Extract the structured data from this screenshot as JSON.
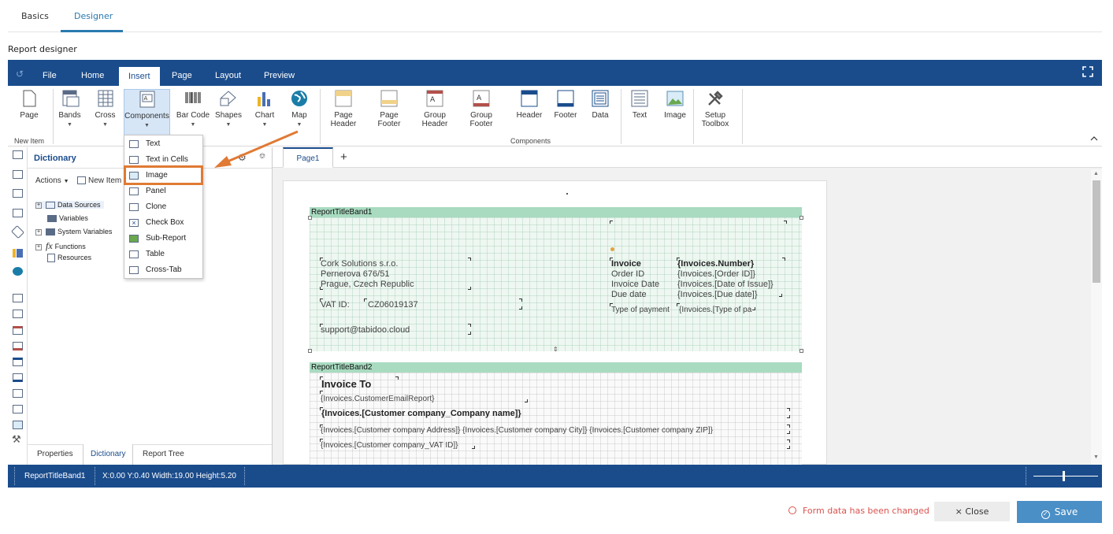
{
  "top_tabs": [
    "Basics",
    "Designer"
  ],
  "section_title": "Report designer",
  "ribbon": {
    "tabs": [
      "File",
      "Home",
      "Insert",
      "Page",
      "Layout",
      "Preview"
    ],
    "buttons": {
      "page": "Page",
      "bands": "Bands",
      "cross": "Cross",
      "components": "Components",
      "barcode": "Bar Code",
      "shapes": "Shapes",
      "chart": "Chart",
      "map": "Map",
      "page_header_1": "Page",
      "page_header_2": "Header",
      "page_footer_1": "Page",
      "page_footer_2": "Footer",
      "group_header_1": "Group",
      "group_header_2": "Header",
      "group_footer_1": "Group",
      "group_footer_2": "Footer",
      "header": "Header",
      "footer": "Footer",
      "data": "Data",
      "text": "Text",
      "image": "Image",
      "setup_toolbox_1": "Setup",
      "setup_toolbox_2": "Toolbox"
    },
    "group_new_item": "New Item",
    "group_components": "Components"
  },
  "dictionary": {
    "title": "Dictionary",
    "actions": "Actions",
    "new_item": "New Item",
    "tree": [
      "Data Sources",
      "Variables",
      "System Variables",
      "Functions",
      "Resources"
    ],
    "bottom_tabs": [
      "Properties",
      "Dictionary",
      "Report Tree"
    ]
  },
  "components_menu": {
    "items": [
      "Text",
      "Text in Cells",
      "Image",
      "Panel",
      "Clone",
      "Check Box",
      "Sub-Report",
      "Table",
      "Cross-Tab"
    ]
  },
  "page_tab": "Page1",
  "report": {
    "band1_name": "ReportTitleBand1",
    "band2_name": "ReportTitleBand2",
    "company_line1": "Cork Solutions s.r.o.",
    "company_line2": "Pernerova 676/51",
    "company_line3": "Prague, Czech Republic",
    "vat_label": "VAT ID:",
    "vat_value": "CZ06019137",
    "support_email": "support@tabidoo.cloud",
    "invoice_label": "Invoice",
    "order_id_label": "Order ID",
    "invoice_date_label": "Invoice Date",
    "due_date_label": "Due date",
    "invoice_number": "{Invoices.Number}",
    "order_id_value": "{Invoices.[Order ID]}",
    "date_of_issue": "{Invoices.[Date of Issue]}",
    "due_date_value": "{Invoices.[Due date]}",
    "payment_label": "Type of payment",
    "payment_value": "{Invoices.[Type of pa",
    "invoice_to": "Invoice To",
    "customer_email": "{Invoices.CustomerEmailReport}",
    "customer_company": "{Invoices.[Customer company_Company name]}",
    "customer_address": "{Invoices.[Customer company  Address]} {Invoices.[Customer company  City]} {Invoices.[Customer company  ZIP]}",
    "customer_vat": "{Invoices.[Customer company_VAT ID]}"
  },
  "status_bar": {
    "component": "ReportTitleBand1",
    "geometry": "X:0.00 Y:0.40 Width:19.00 Height:5.20"
  },
  "footer": {
    "changed": "Form data has been changed",
    "close": "Close",
    "save": "Save"
  },
  "colors": {
    "ribbon": "#1a4c8c",
    "band_header": "#a8dbc0",
    "highlight": "#e07a34",
    "save": "#4a8fc6"
  }
}
